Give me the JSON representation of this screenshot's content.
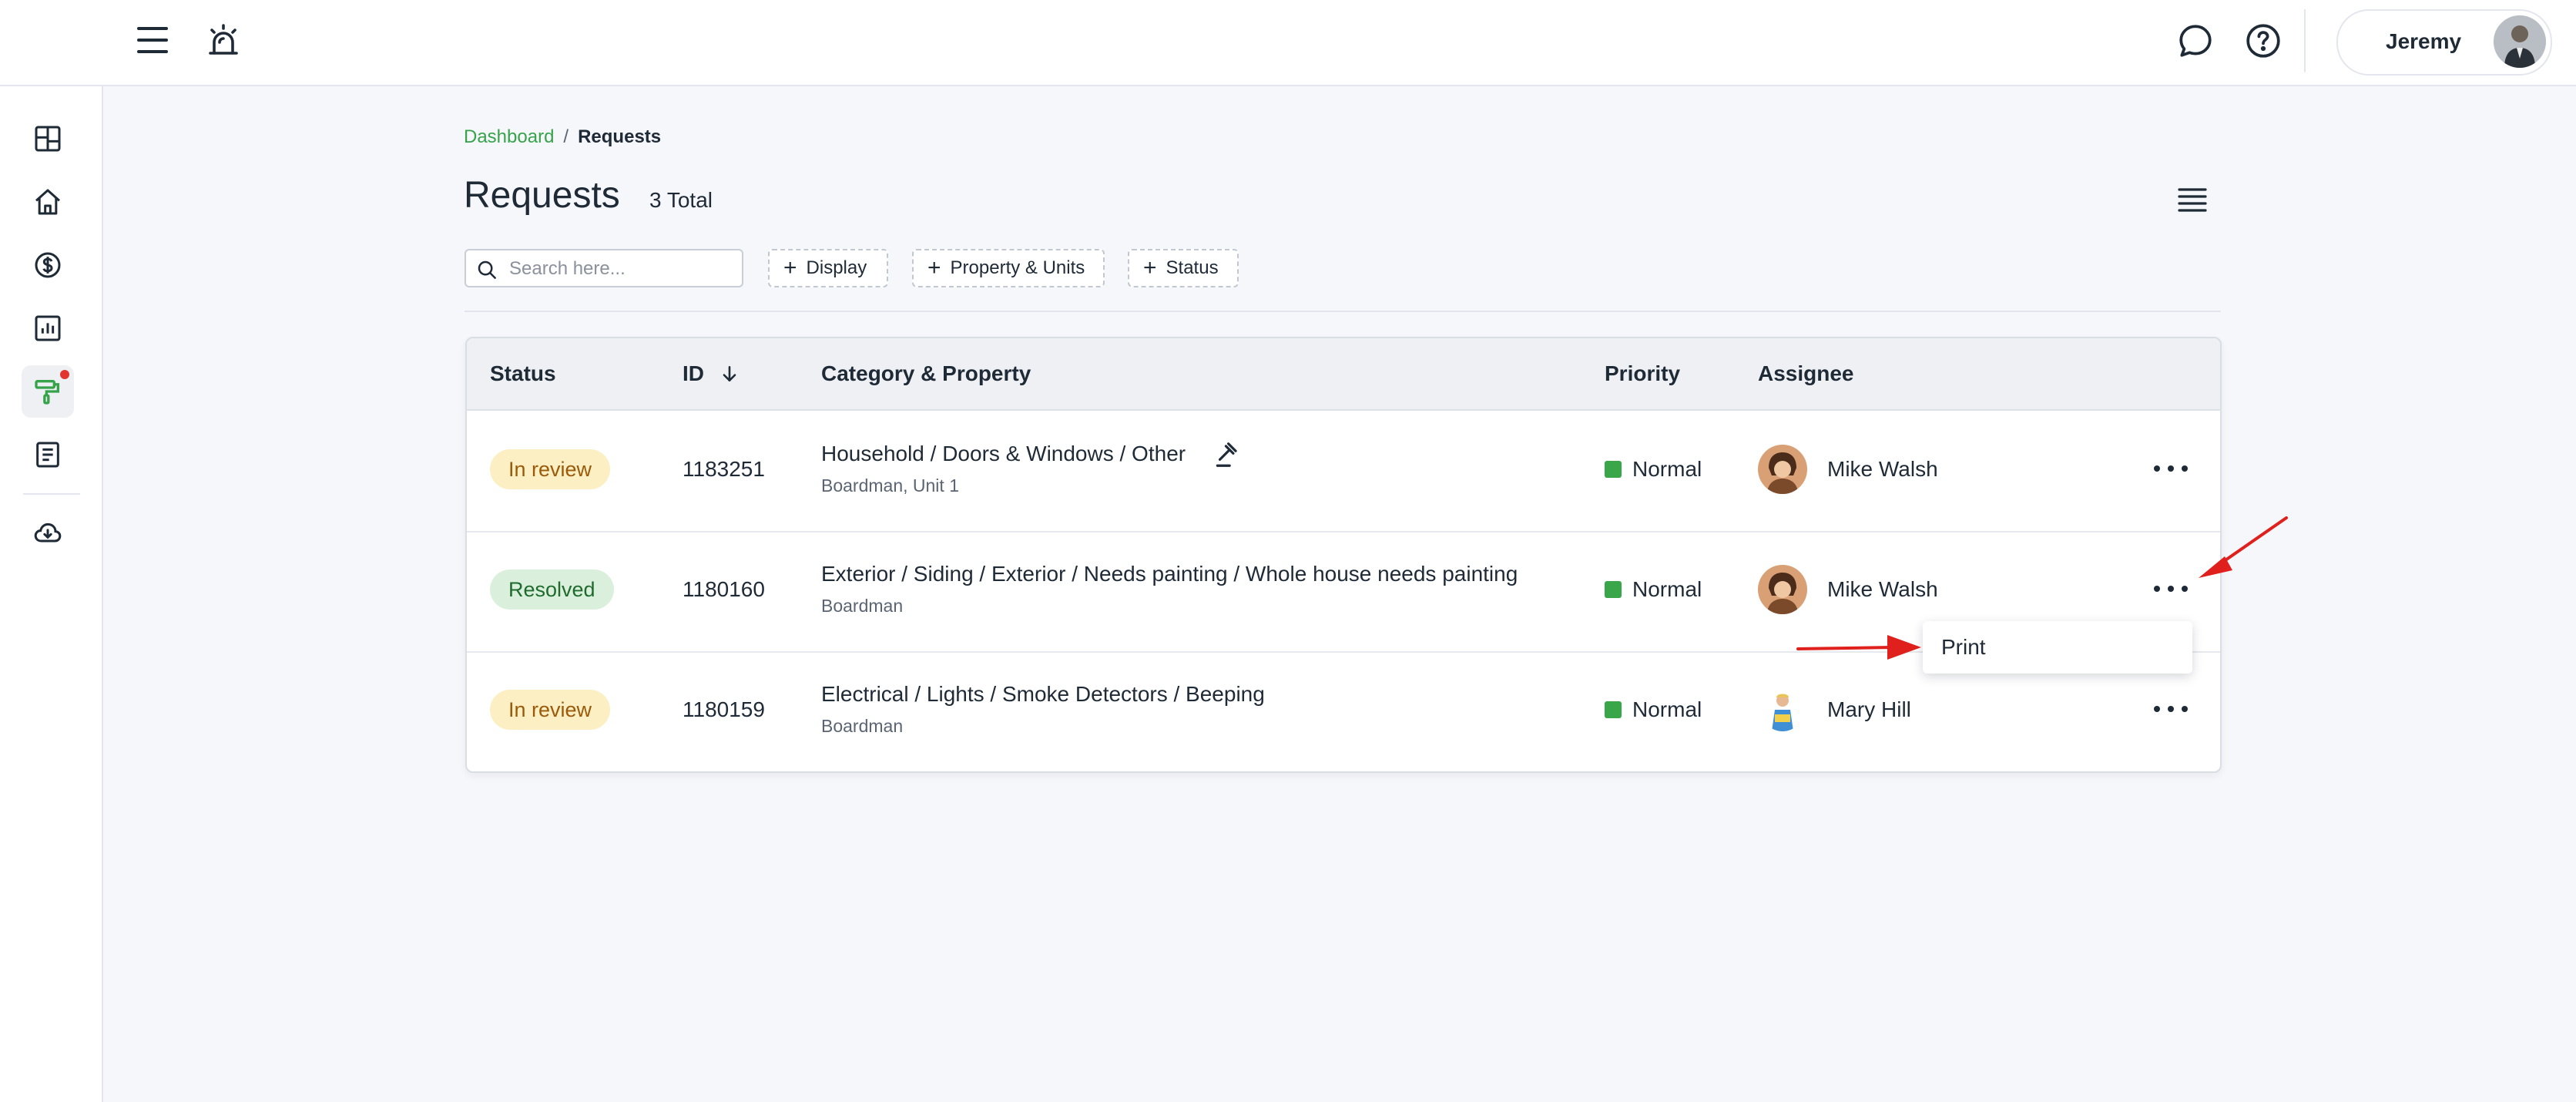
{
  "header": {
    "user_name": "Jeremy"
  },
  "sidebar": {
    "items": [
      "dashboard-icon",
      "home-icon",
      "dollar-icon",
      "chart-icon",
      "maintenance-icon",
      "document-icon",
      "download-icon"
    ]
  },
  "breadcrumb": {
    "parent": "Dashboard",
    "separator": "/",
    "current": "Requests"
  },
  "page": {
    "title": "Requests",
    "total": "3 Total"
  },
  "filters": {
    "search_placeholder": "Search here...",
    "display": "Display",
    "property_units": "Property & Units",
    "status": "Status"
  },
  "table": {
    "headers": {
      "status": "Status",
      "id": "ID",
      "category": "Category & Property",
      "priority": "Priority",
      "assignee": "Assignee"
    },
    "rows": [
      {
        "status": "In review",
        "id": "1183251",
        "category": "Household / Doors & Windows / Other",
        "property": "Boardman, Unit 1",
        "priority": "Normal",
        "assignee": "Mike Walsh"
      },
      {
        "status": "Resolved",
        "id": "1180160",
        "category": "Exterior / Siding / Exterior / Needs painting / Whole house needs painting",
        "property": "Boardman",
        "priority": "Normal",
        "assignee": "Mike Walsh"
      },
      {
        "status": "In review",
        "id": "1180159",
        "category": "Electrical / Lights / Smoke Detectors / Beeping",
        "property": "Boardman",
        "priority": "Normal",
        "assignee": "Mary Hill"
      }
    ]
  },
  "context_menu": {
    "print": "Print"
  },
  "colors": {
    "accent_green": "#36a34a",
    "priority_normal": "#3aa64a",
    "badge_review_bg": "#fcefc4",
    "badge_resolved_bg": "#dbf0dc",
    "annotation_arrow": "#e0201c"
  }
}
